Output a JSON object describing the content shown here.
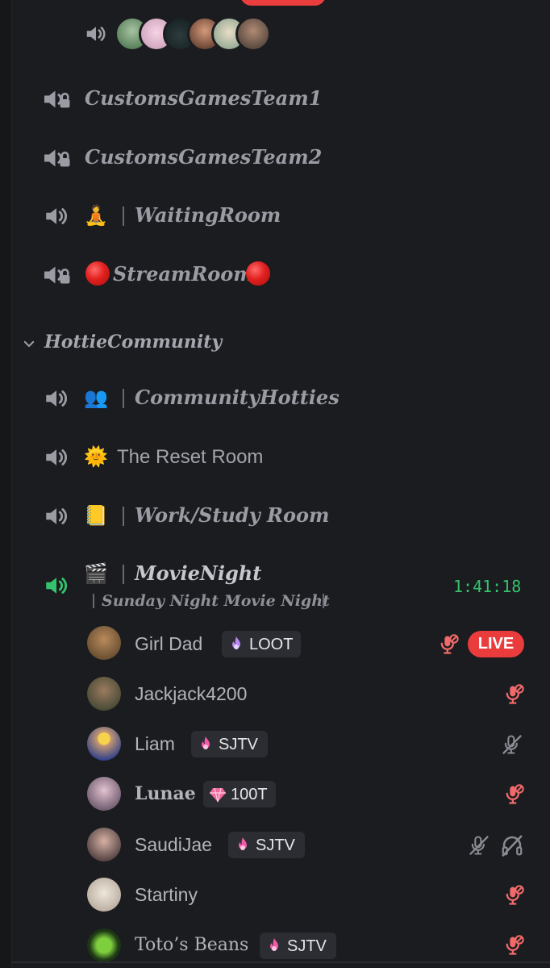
{
  "channels": [
    {
      "name": "CustomsGamesTeam1"
    },
    {
      "name": "CustomsGamesTeam2"
    },
    {
      "emoji": "🧘",
      "name": "WaitingRoom"
    },
    {
      "name": "StreamRoom"
    }
  ],
  "category": {
    "label": "HottieCommunity"
  },
  "community_channels": [
    {
      "emoji": "👥",
      "name": "CommunityHotties"
    },
    {
      "emoji": "🌞",
      "name": "The Reset Room"
    },
    {
      "emoji": "📒",
      "name": "Work/Study Room"
    },
    {
      "emoji": "🎬",
      "name": "MovieNight",
      "timer": "1:41:18",
      "topic": "Sunday Night Movie Night"
    }
  ],
  "users": [
    {
      "name": "Girl Dad",
      "tag": "LOOT",
      "status": "LIVE"
    },
    {
      "name": "Jackjack4200"
    },
    {
      "name": "Liam",
      "tag": "SJTV"
    },
    {
      "name": "Lunae",
      "tag": "100T"
    },
    {
      "name": "SaudiJae",
      "tag": "SJTV"
    },
    {
      "name": "Startiny"
    },
    {
      "name": "Toto’s Beans",
      "tag": "SJTV"
    }
  ],
  "colors": {
    "background": "#1b1c20",
    "active_voice": "#34c26c",
    "live_red": "#ea3c3c",
    "muted_mic_red": "#f06a6a",
    "muted_grey": "#8a8b92",
    "tag_bg": "#2c2d33"
  },
  "icons": {
    "voice": "speaker-icon",
    "locked_voice": "speaker-lock-icon",
    "collapse": "chevron-down-icon",
    "mic_muted": "mic-muted-icon",
    "deafened": "headphones-off-icon"
  }
}
